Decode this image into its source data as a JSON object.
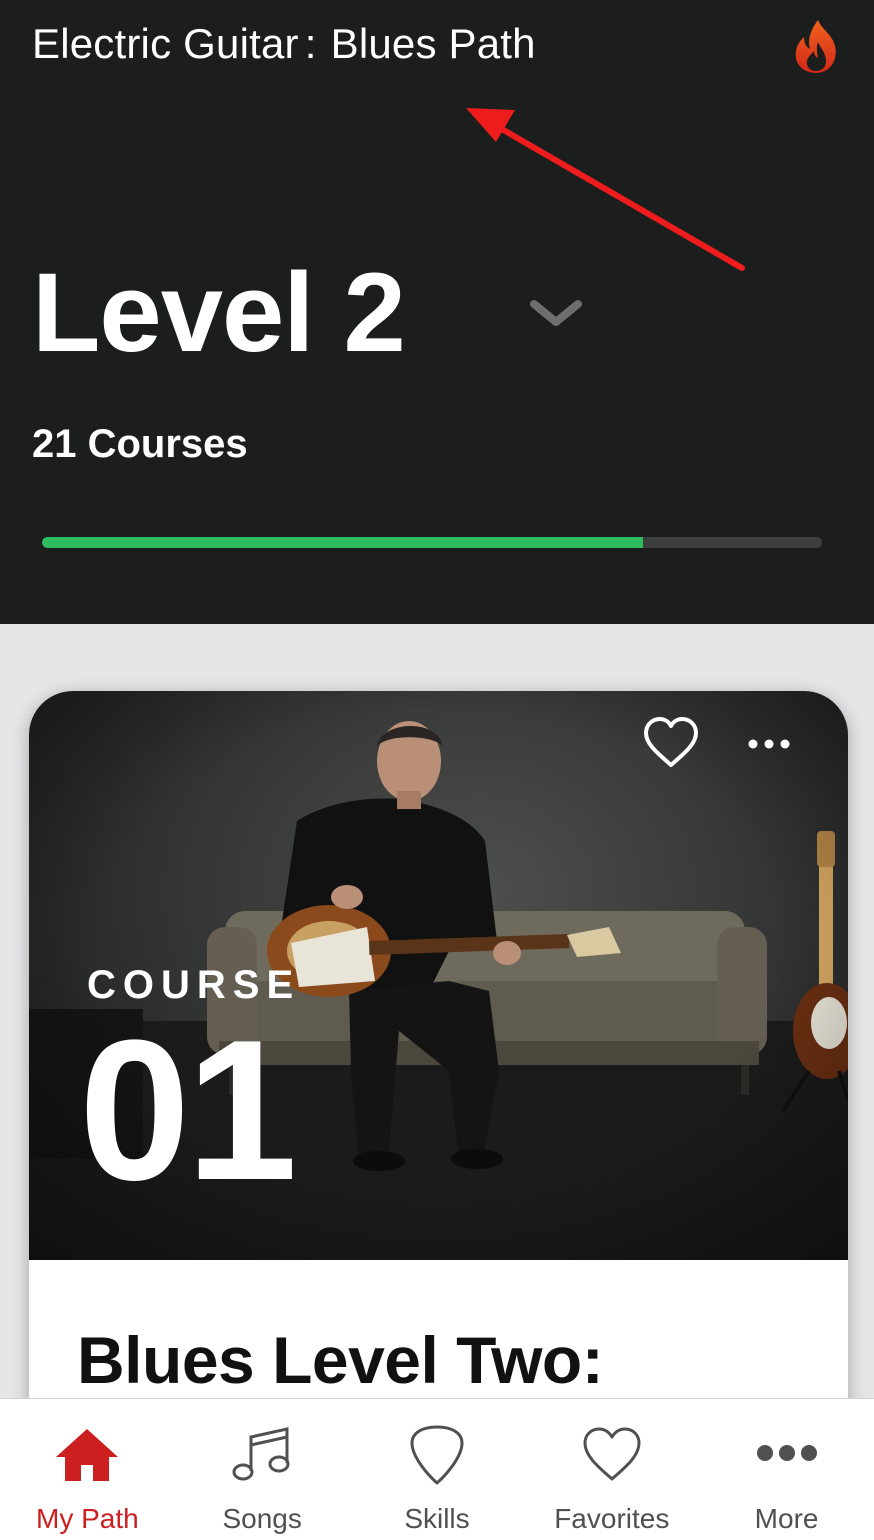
{
  "header": {
    "instrument": "Electric Guitar",
    "separator": ":",
    "path_name": "Blues Path",
    "streak_icon": "fire-icon",
    "level_title": "Level 2",
    "course_count": "21 Courses",
    "progress": 0.77
  },
  "card": {
    "course_label": "COURSE",
    "course_number": "01",
    "title": "Blues Level Two:",
    "favorite_icon": "heart-outline-icon",
    "more_icon": "ellipsis-icon"
  },
  "tabs": [
    {
      "label": "My Path",
      "icon": "home-icon",
      "active": true
    },
    {
      "label": "Songs",
      "icon": "music-note-icon",
      "active": false
    },
    {
      "label": "Skills",
      "icon": "guitar-pick-icon",
      "active": false
    },
    {
      "label": "Favorites",
      "icon": "heart-icon",
      "active": false
    },
    {
      "label": "More",
      "icon": "ellipsis-icon",
      "active": false
    }
  ],
  "colors": {
    "header_bg": "#1c1d1d",
    "progress": "#2ebd5e",
    "accent": "#cc1f1f",
    "annotation_arrow": "#ee1c1c"
  }
}
